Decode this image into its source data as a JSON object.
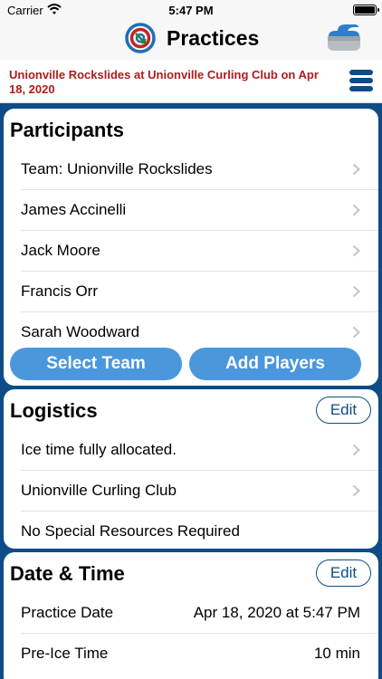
{
  "status_bar": {
    "carrier": "Carrier",
    "time": "5:47 PM"
  },
  "nav": {
    "title": "Practices"
  },
  "event": {
    "title": "Unionville Rockslides at Unionville Curling Club on Apr 18, 2020"
  },
  "participants": {
    "title": "Participants",
    "rows": [
      {
        "label": "Team: Unionville Rockslides"
      },
      {
        "label": "James Accinelli"
      },
      {
        "label": "Jack Moore"
      },
      {
        "label": "Francis Orr"
      },
      {
        "label": "Sarah Woodward"
      }
    ],
    "select_team_label": "Select Team",
    "add_players_label": "Add Players"
  },
  "logistics": {
    "title": "Logistics",
    "edit_label": "Edit",
    "rows": [
      {
        "label": "Ice time fully allocated."
      },
      {
        "label": "Unionville Curling Club"
      },
      {
        "label": "No Special Resources Required"
      }
    ]
  },
  "datetime": {
    "title": "Date & Time",
    "edit_label": "Edit",
    "rows": [
      {
        "label": "Practice Date",
        "value": "Apr 18, 2020 at 5:47 PM"
      },
      {
        "label": "Pre-Ice Time",
        "value": "10 min"
      }
    ]
  },
  "colors": {
    "accent": "#0d4c86",
    "button": "#4a97dc",
    "event_title": "#b01b1b"
  }
}
